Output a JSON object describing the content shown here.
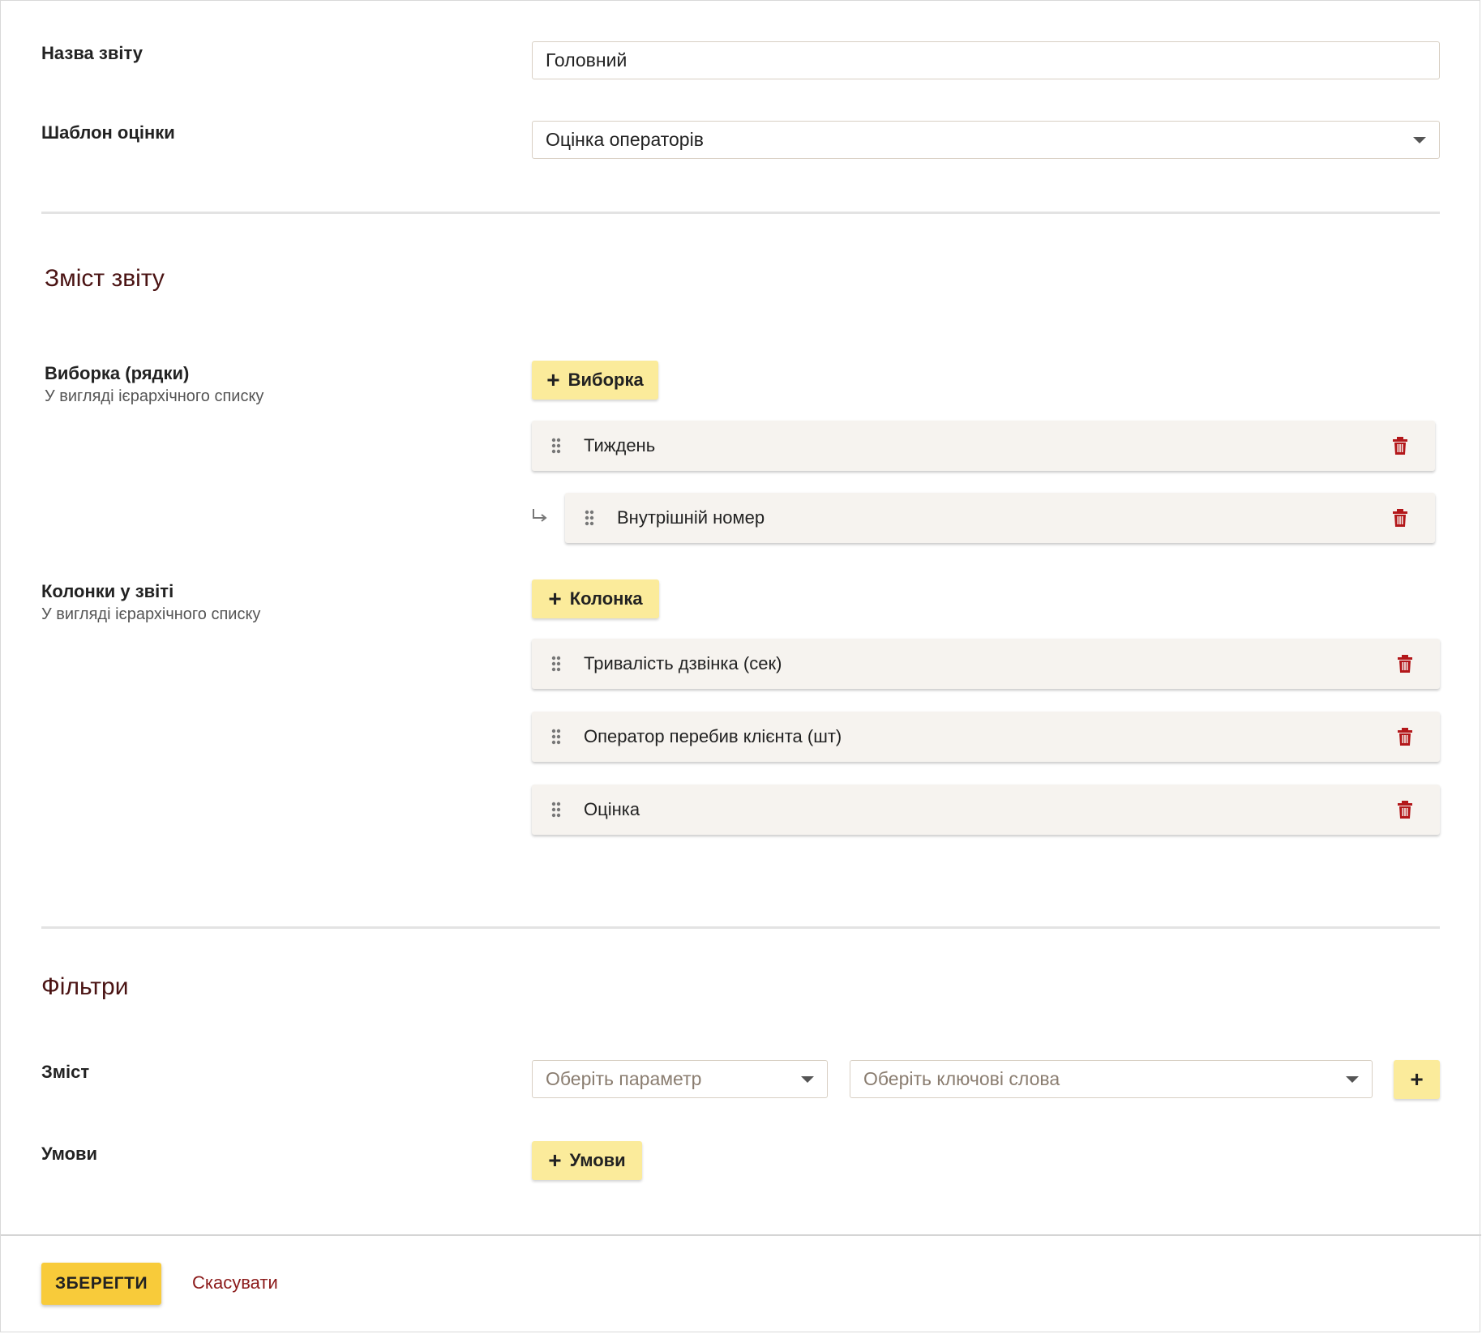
{
  "form": {
    "report_name_label": "Назва звіту",
    "report_name_value": "Головний",
    "template_label": "Шаблон оцінки",
    "template_value": "Оцінка операторів"
  },
  "content": {
    "title": "Зміст звіту",
    "rows_label": "Виборка (рядки)",
    "rows_sublabel": "У вигляді ієрархічного списку",
    "add_row_label": "Виборка",
    "rows": [
      {
        "label": "Тиждень"
      },
      {
        "label": "Внутрішній номер"
      }
    ],
    "columns_label": "Колонки у звіті",
    "columns_sublabel": "У вигляді ієрархічного списку",
    "add_column_label": "Колонка",
    "columns": [
      {
        "label": "Тривалість дзвінка (сек)"
      },
      {
        "label": "Оператор перебив клієнта (шт)"
      },
      {
        "label": "Оцінка"
      }
    ]
  },
  "filters": {
    "title": "Фільтри",
    "content_label": "Зміст",
    "param_placeholder": "Оберіть параметр",
    "keywords_placeholder": "Оберіть ключові слова",
    "conditions_label": "Умови",
    "add_conditions_label": "Умови"
  },
  "footer": {
    "save_label": "ЗБЕРЕГТИ",
    "cancel_label": "Скасувати"
  },
  "colors": {
    "accent_yellow": "#fbeb9b",
    "save_yellow": "#f8cb3a",
    "danger_red": "#8b1a1a",
    "title_maroon": "#4a1313"
  }
}
